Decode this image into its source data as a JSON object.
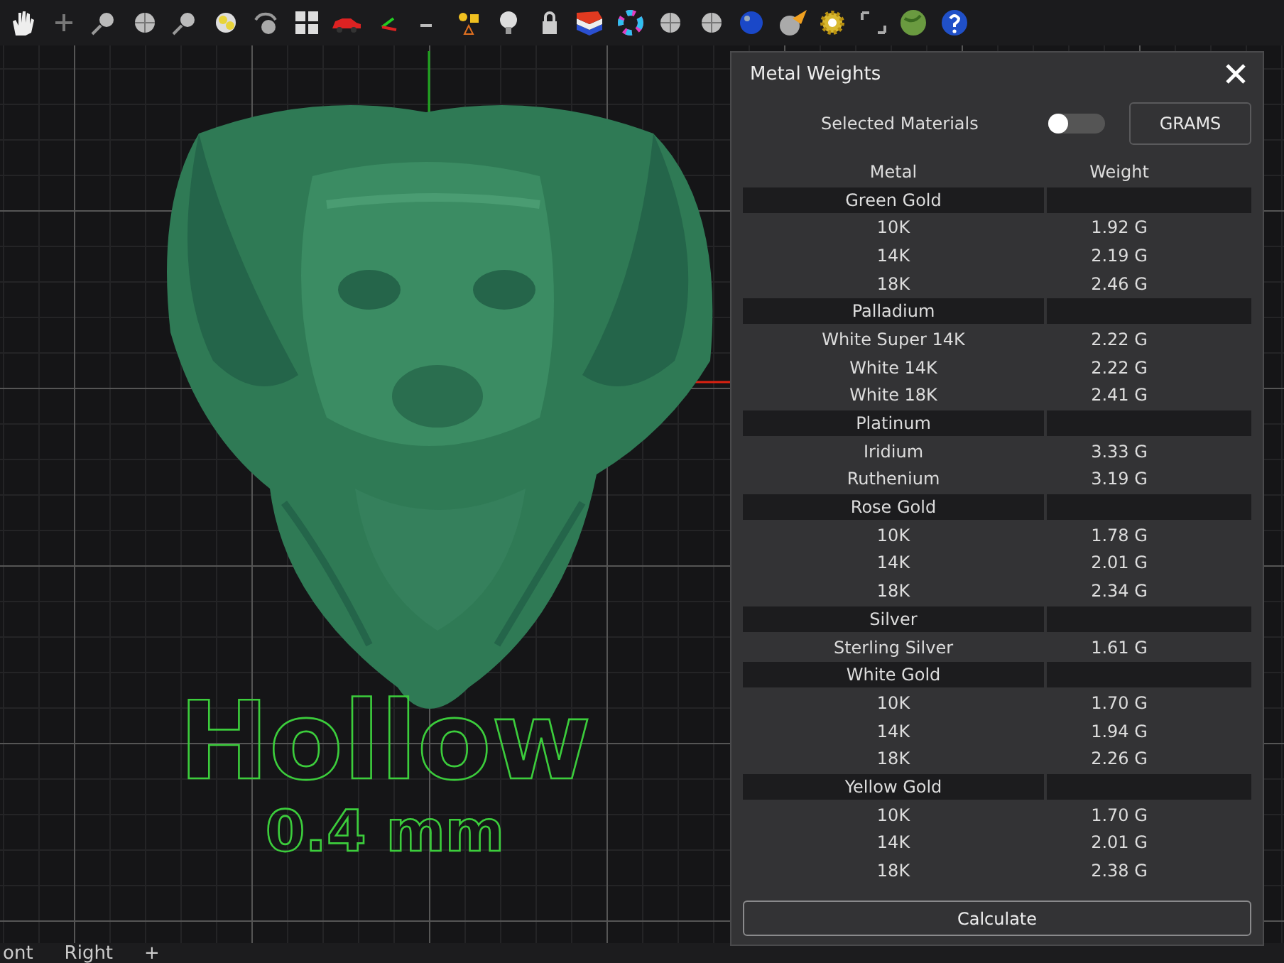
{
  "panel": {
    "title": "Metal Weights",
    "toggle": {
      "label": "Selected Materials",
      "on": false
    },
    "unit_button": "GRAMS",
    "calculate_button": "Calculate"
  },
  "table": {
    "columns": [
      "Metal",
      "Weight"
    ],
    "groups": [
      {
        "name": "Green Gold",
        "rows": [
          {
            "metal": "10K",
            "weight": "1.92 G"
          },
          {
            "metal": "14K",
            "weight": "2.19 G"
          },
          {
            "metal": "18K",
            "weight": "2.46 G"
          }
        ]
      },
      {
        "name": "Palladium",
        "rows": [
          {
            "metal": "White Super 14K",
            "weight": "2.22 G"
          },
          {
            "metal": "White 14K",
            "weight": "2.22 G"
          },
          {
            "metal": "White 18K",
            "weight": "2.41 G"
          }
        ]
      },
      {
        "name": "Platinum",
        "rows": [
          {
            "metal": "Iridium",
            "weight": "3.33 G"
          },
          {
            "metal": "Ruthenium",
            "weight": "3.19 G"
          }
        ]
      },
      {
        "name": "Rose Gold",
        "rows": [
          {
            "metal": "10K",
            "weight": "1.78 G"
          },
          {
            "metal": "14K",
            "weight": "2.01 G"
          },
          {
            "metal": "18K",
            "weight": "2.34 G"
          }
        ]
      },
      {
        "name": "Silver",
        "rows": [
          {
            "metal": "Sterling Silver",
            "weight": "1.61 G"
          }
        ]
      },
      {
        "name": "White Gold",
        "rows": [
          {
            "metal": "10K",
            "weight": "1.70 G"
          },
          {
            "metal": "14K",
            "weight": "1.94 G"
          },
          {
            "metal": "18K",
            "weight": "2.26 G"
          }
        ]
      },
      {
        "name": "Yellow Gold",
        "rows": [
          {
            "metal": "10K",
            "weight": "1.70 G"
          },
          {
            "metal": "14K",
            "weight": "2.01 G"
          },
          {
            "metal": "18K",
            "weight": "2.38 G"
          }
        ]
      }
    ]
  },
  "overlay": {
    "title": "Hollow",
    "subtitle": "0.4 mm"
  },
  "view_tabs": [
    "ont",
    "Right",
    "+"
  ]
}
